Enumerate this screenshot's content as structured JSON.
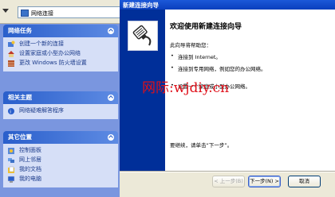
{
  "explorer": {
    "address": "网络连接",
    "panels": [
      {
        "title": "网络任务",
        "tasks": [
          "创建一个新的连接",
          "设置家庭或小型办公网络",
          "更改 Windows 防火墙设置"
        ]
      },
      {
        "title": "相关主题",
        "tasks": [
          "网络疑难解答程序"
        ]
      },
      {
        "title": "其它位置",
        "tasks": [
          "控制面板",
          "网上邻居",
          "我的文档",
          "我的电脑"
        ]
      }
    ]
  },
  "wizard": {
    "title": "新建连接向导",
    "heading": "欢迎使用新建连接向导",
    "intro": "此向导将帮助您：",
    "bullets": [
      "连接到 Internet。",
      "连接到专用网络，例如您的办公网络。",
      "设置一个家庭或小型办公网络。"
    ],
    "continue_text": "要继续，请单击“下一步”。",
    "buttons": {
      "back": "< 上一步(B)",
      "next": "下一步(N) >",
      "cancel": "取消"
    }
  },
  "watermark": "网际:wjdiy.cn"
}
